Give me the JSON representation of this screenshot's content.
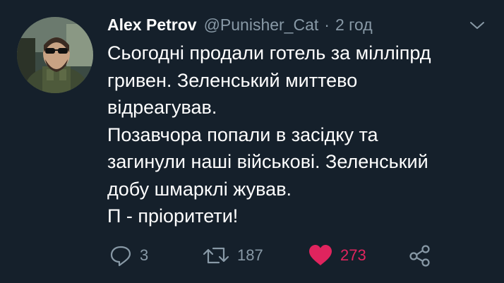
{
  "tweet": {
    "author": {
      "name": "Alex Petrov",
      "handle": "@Punisher_Cat",
      "time": "2 год"
    },
    "body": [
      "Сьогодні продали готель за мілліпрд",
      "гривен. Зеленський миттево",
      "відреагував.",
      "Позавчора попали в засідку та",
      "загинули наші військові. Зеленський",
      "добу шмарклі жував.",
      "П - пріоритети!"
    ],
    "actions": {
      "reply_count": "3",
      "retweet_count": "187",
      "like_count": "273"
    },
    "icons": {
      "reply": "reply-icon",
      "retweet": "retweet-icon",
      "like": "heart-icon",
      "share": "share-icon",
      "menu": "chevron-down-icon"
    },
    "colors": {
      "background": "#15202b",
      "secondary_text": "#8899a6",
      "like": "#e0245e"
    },
    "separator": "·"
  }
}
